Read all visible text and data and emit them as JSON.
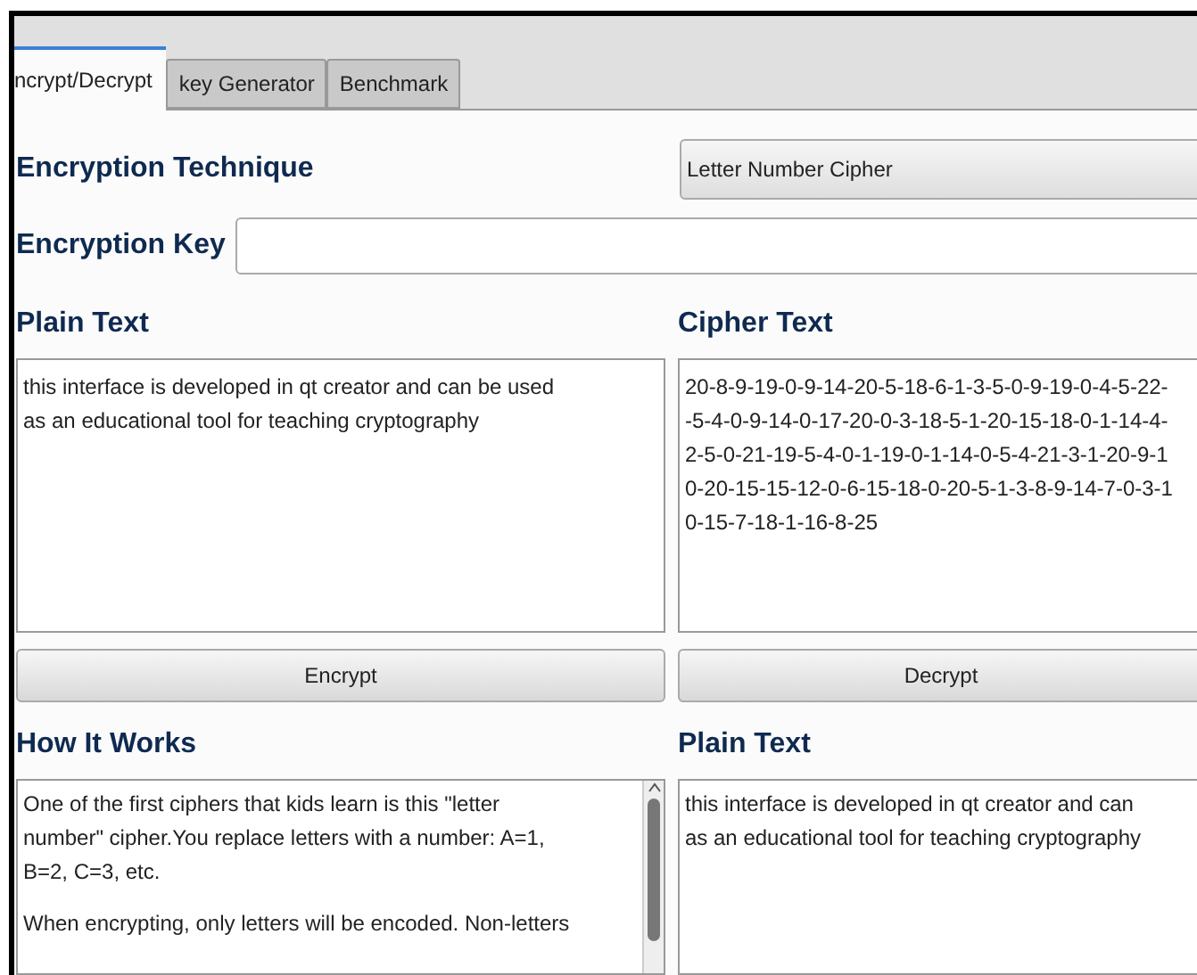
{
  "tabs": [
    {
      "label": "ncrypt/Decrypt",
      "selected": true
    },
    {
      "label": "key Generator",
      "selected": false
    },
    {
      "label": "Benchmark",
      "selected": false
    }
  ],
  "technique": {
    "label": "Encryption Technique",
    "value": "Letter Number Cipher"
  },
  "key": {
    "label": "Encryption Key"
  },
  "plain_text": {
    "label": "Plain Text",
    "lines": [
      "this interface is developed in qt creator and can be used",
      "as an educational tool for teaching cryptography"
    ]
  },
  "cipher_text": {
    "label": "Cipher Text",
    "lines": [
      "20-8-9-19-0-9-14-20-5-18-6-1-3-5-0-9-19-0-4-5-22-",
      "-5-4-0-9-14-0-17-20-0-3-18-5-1-20-15-18-0-1-14-4-",
      "2-5-0-21-19-5-4-0-1-19-0-1-14-0-5-4-21-3-1-20-9-1",
      "0-20-15-15-12-0-6-15-18-0-20-5-1-3-8-9-14-7-0-3-1",
      "0-15-7-18-1-16-8-25"
    ]
  },
  "buttons": [
    "Encrypt",
    "Decrypt"
  ],
  "how_it_works": {
    "label": "How It Works",
    "paragraphs": [
      [
        "One of the first ciphers that kids learn is this \"letter",
        "number\" cipher.You replace letters with a number: A=1,",
        "B=2, C=3, etc."
      ],
      [
        "When encrypting, only letters will be encoded. Non-letters"
      ]
    ]
  },
  "decrypted": {
    "label": "Plain Text",
    "lines": [
      "this interface is developed in qt creator and can",
      "as an educational tool for teaching cryptography"
    ]
  }
}
